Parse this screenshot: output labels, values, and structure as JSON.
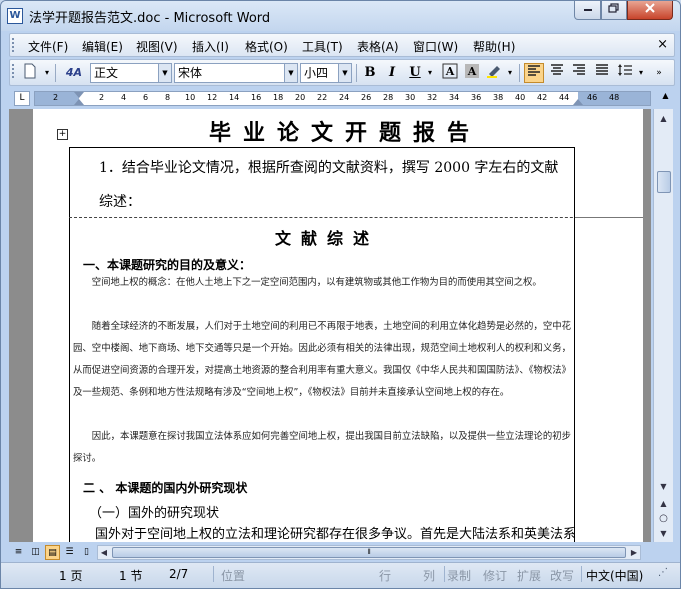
{
  "window": {
    "app_icon": "W",
    "title": "法学开题报告范文.doc - Microsoft Word",
    "minimize": "0",
    "maximize": "1",
    "close": "r"
  },
  "menubar": {
    "items": [
      "文件(F)",
      "编辑(E)",
      "视图(V)",
      "插入(I)",
      "格式(O)",
      "工具(T)",
      "表格(A)",
      "窗口(W)",
      "帮助(H)"
    ],
    "close": "×"
  },
  "toolbar": {
    "style_value": "正文",
    "font_value": "宋体",
    "size_value": "小四",
    "bold": "B",
    "italic": "I",
    "underline": "U",
    "style_icon": "4A",
    "buttons": [
      "char-border",
      "char-shading",
      "highlight",
      "align-left",
      "align-center",
      "align-right",
      "justify",
      "line-spacing"
    ]
  },
  "ruler": {
    "corner": "L",
    "ticks": [
      "2",
      "2",
      "4",
      "6",
      "8",
      "10",
      "12",
      "14",
      "16",
      "18",
      "20",
      "22",
      "24",
      "26",
      "28",
      "30",
      "32",
      "34",
      "36",
      "38",
      "40",
      "42",
      "44",
      "46",
      "48"
    ]
  },
  "document": {
    "title": "毕业论文开题报告",
    "question": "1．结合毕业论文情况，根据所查阅的文献资料，撰写 2000 字左右的文献",
    "question_cont": "综述：",
    "review_title": "文献综述",
    "heading1": "一、本课题研究的目的及意义：",
    "para1": "空间地上权的概念：在他人土地上下之一定空间范围内，以有建筑物或其他工作物为目的而使用其空间之权。",
    "para2": "随着全球经济的不断发展，人们对于土地空间的利用已不再限于地表，土地空间的利用立体化趋势是必然的，空中花园、空中楼阁、地下商场、地下交通等只是一个开始。因此必须有相关的法律出现，规范空间土地权利人的权利和义务，从而促进空间资源的合理开发，对提高土地资源的整合利用率有重大意义。我国仅《中华人民共和国国防法》、《物权法》及一些规范、条例和地方性法规略有涉及“空间地上权”，《物权法》目前并未直接承认空间地上权的存在。",
    "para3": "因此，本课题意在探讨我国立法体系应如何完善空间地上权，提出我国目前立法缺陷，以及提供一些立法理论的初步探讨。",
    "heading2": "二 、 本课题的国内外研究现状",
    "sub1": "（一）国外的研究现状",
    "body1": "国外对于空间地上权的立法和理论研究都存在很多争议。首先是大陆法系和英美法系"
  },
  "statusbar": {
    "page": "1 页",
    "section": "1 节",
    "page_of": "2/7",
    "position": "位置",
    "line": "行",
    "column": "列",
    "rec": "录制",
    "trk": "修订",
    "ext": "扩展",
    "ovr": "改写",
    "language": "中文(中国)"
  }
}
